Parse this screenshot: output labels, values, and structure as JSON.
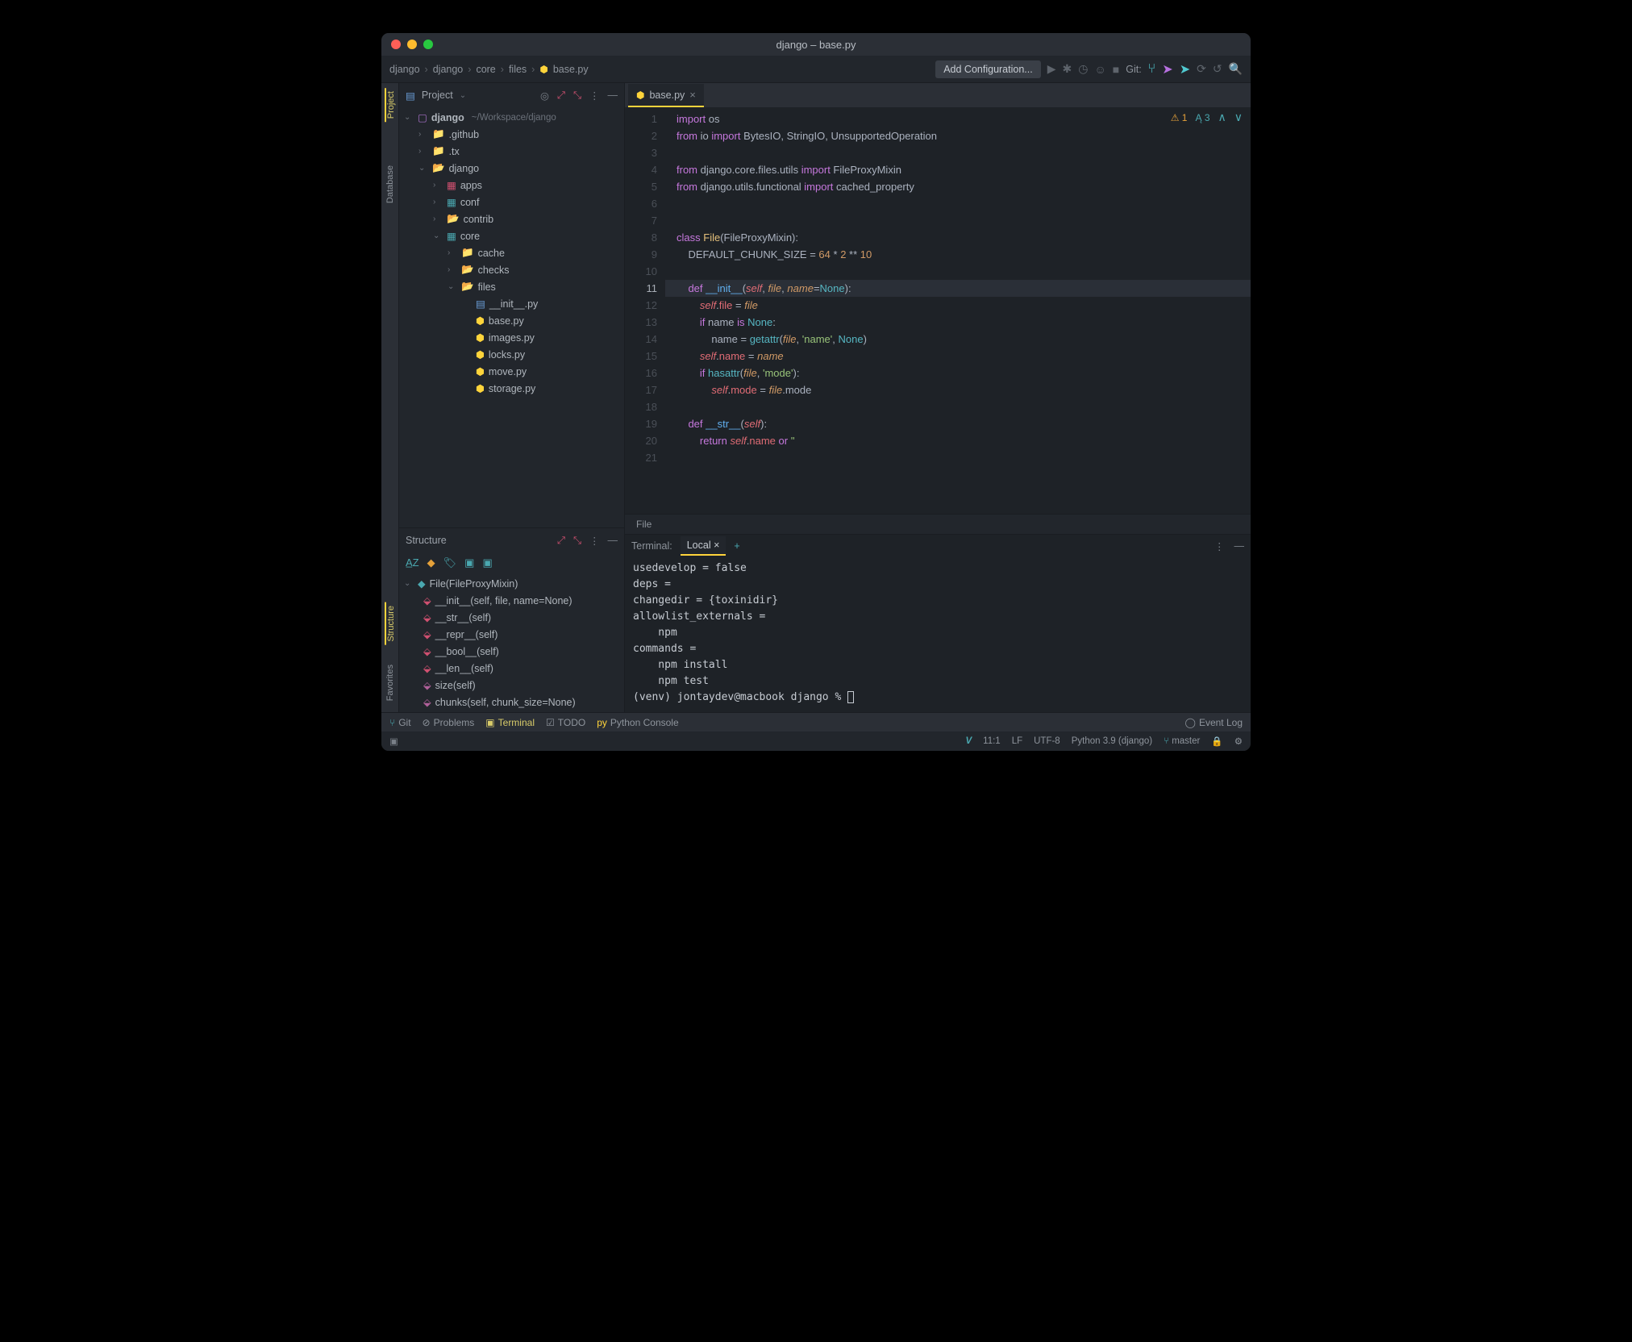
{
  "window": {
    "title": "django – base.py"
  },
  "breadcrumbs": [
    "django",
    "django",
    "core",
    "files",
    "base.py"
  ],
  "toolbar": {
    "addConfig": "Add Configuration...",
    "gitLabel": "Git:"
  },
  "project": {
    "label": "Project",
    "root": {
      "name": "django",
      "path": "~/Workspace/django"
    },
    "tree": [
      {
        "name": ".github",
        "icon": "folder",
        "depth": 1,
        "arrow": "›"
      },
      {
        "name": ".tx",
        "icon": "folder",
        "depth": 1,
        "arrow": "›"
      },
      {
        "name": "django",
        "icon": "folder-open",
        "depth": 1,
        "arrow": "⌄"
      },
      {
        "name": "apps",
        "icon": "pkg-red",
        "depth": 2,
        "arrow": "›"
      },
      {
        "name": "conf",
        "icon": "pkg-teal",
        "depth": 2,
        "arrow": "›"
      },
      {
        "name": "contrib",
        "icon": "folder-open",
        "depth": 2,
        "arrow": "›"
      },
      {
        "name": "core",
        "icon": "pkg-teal",
        "depth": 2,
        "arrow": "⌄"
      },
      {
        "name": "cache",
        "icon": "folder",
        "depth": 3,
        "arrow": "›"
      },
      {
        "name": "checks",
        "icon": "folder-open",
        "depth": 3,
        "arrow": "›"
      },
      {
        "name": "files",
        "icon": "folder-open",
        "depth": 3,
        "arrow": "⌄"
      },
      {
        "name": "__init__.py",
        "icon": "py-init",
        "depth": 4,
        "arrow": ""
      },
      {
        "name": "base.py",
        "icon": "py",
        "depth": 4,
        "arrow": ""
      },
      {
        "name": "images.py",
        "icon": "py",
        "depth": 4,
        "arrow": ""
      },
      {
        "name": "locks.py",
        "icon": "py",
        "depth": 4,
        "arrow": ""
      },
      {
        "name": "move.py",
        "icon": "py",
        "depth": 4,
        "arrow": ""
      },
      {
        "name": "storage.py",
        "icon": "py",
        "depth": 4,
        "arrow": ""
      }
    ]
  },
  "structure": {
    "label": "Structure",
    "root": "File(FileProxyMixin)",
    "items": [
      "__init__(self, file, name=None)",
      "__str__(self)",
      "__repr__(self)",
      "__bool__(self)",
      "__len__(self)",
      "size(self)",
      "chunks(self, chunk_size=None)"
    ]
  },
  "editorTab": {
    "name": "base.py",
    "close": "×"
  },
  "badges": {
    "warn": "1",
    "inspect": "3"
  },
  "code": {
    "lines": 21,
    "current": 11
  },
  "breadcrumb2": "File",
  "terminal": {
    "label": "Terminal:",
    "tab": "Local",
    "lines": [
      "usedevelop = false",
      "deps =",
      "changedir = {toxinidir}",
      "allowlist_externals =",
      "    npm",
      "commands =",
      "    npm install",
      "    npm test",
      "(venv) jontaydev@macbook django % "
    ]
  },
  "bottom": {
    "git": "Git",
    "problems": "Problems",
    "terminal": "Terminal",
    "todo": "TODO",
    "pyconsole": "Python Console",
    "eventlog": "Event Log"
  },
  "status": {
    "pos": "11:1",
    "lf": "LF",
    "enc": "UTF-8",
    "interp": "Python 3.9 (django)",
    "branch": "master"
  },
  "leftRail": {
    "project": "Project",
    "structure": "Structure",
    "favorites": "Favorites",
    "database": "Database"
  }
}
